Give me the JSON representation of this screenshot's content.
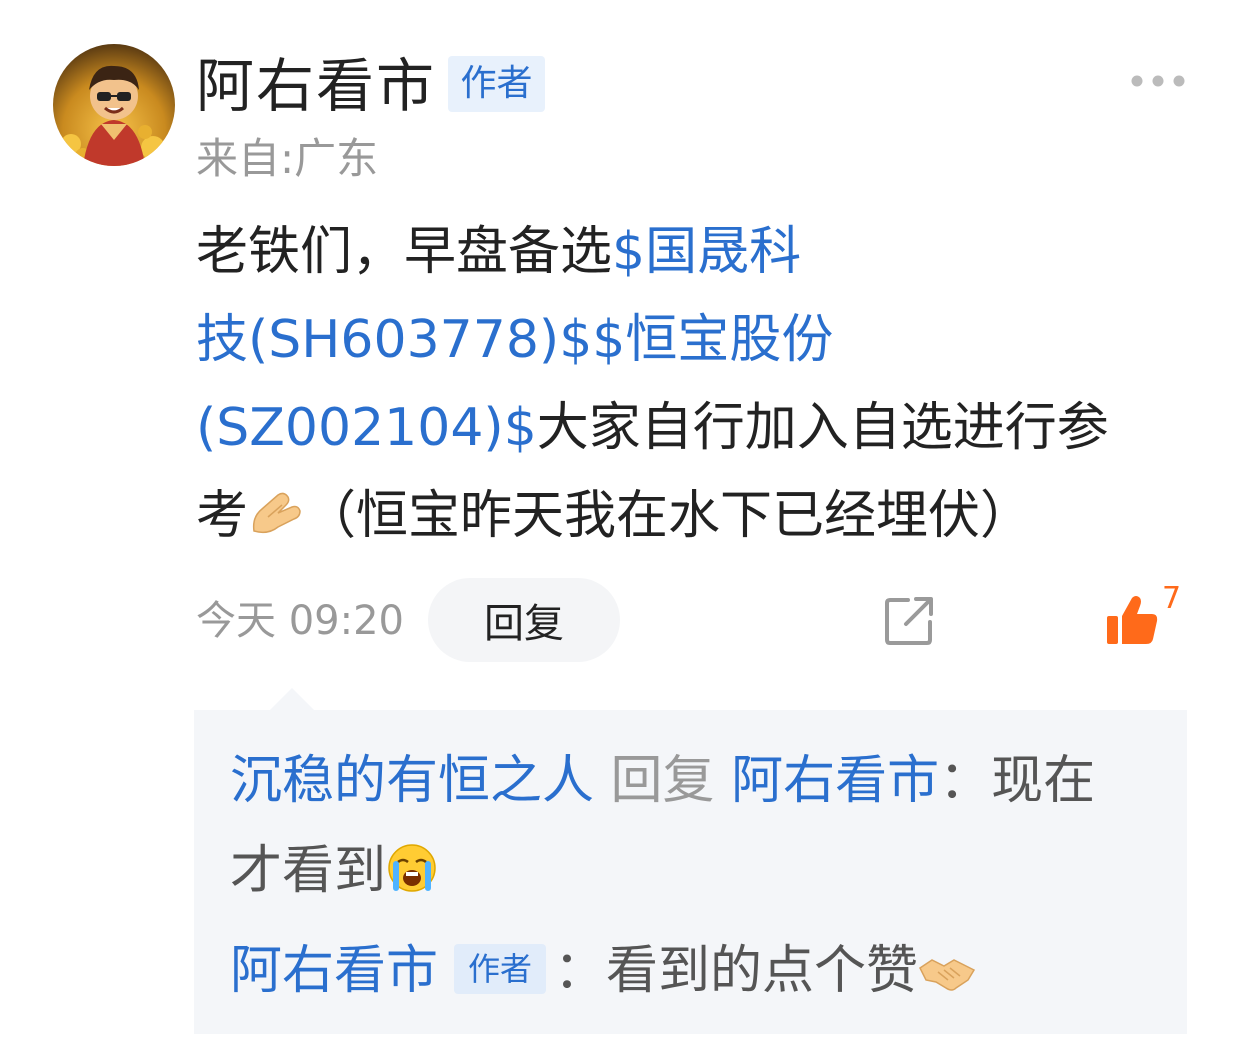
{
  "post": {
    "author": {
      "name": "阿右看市",
      "badge": "作者",
      "location": "来自:广东"
    },
    "body": {
      "line1_text": "老铁们，早盘备选",
      "stock1_part1": "$国晟科",
      "stock1_part2": "技(SH603778)$",
      "stock2_part1": "$恒宝股份",
      "stock2_part2": "(SZ002104)$",
      "line3_text": "大家自行加入自选进行参",
      "line4_text_a": "考",
      "line4_text_b": "（恒宝昨天我在水下已经埋伏）"
    },
    "timestamp": "今天 09:20",
    "reply_label": "回复",
    "like_count": "7"
  },
  "replies": [
    {
      "from": "沉稳的有恒之人",
      "reply_word": "回复",
      "to": "阿右看市",
      "separator": "：",
      "text_a": "现在",
      "text_b": "才看到"
    },
    {
      "from": "阿右看市",
      "badge": "作者",
      "separator": "：",
      "text": "看到的点个赞"
    }
  ],
  "colors": {
    "link": "#2a6fce",
    "secondary_text": "#999999",
    "like": "#ff6a1a",
    "panel_bg": "#f4f6f9"
  },
  "icons": [
    "more-icon",
    "share-icon",
    "thumbs-up-icon",
    "pinched-fingers-emoji",
    "crying-face-emoji",
    "handshake-emoji"
  ]
}
